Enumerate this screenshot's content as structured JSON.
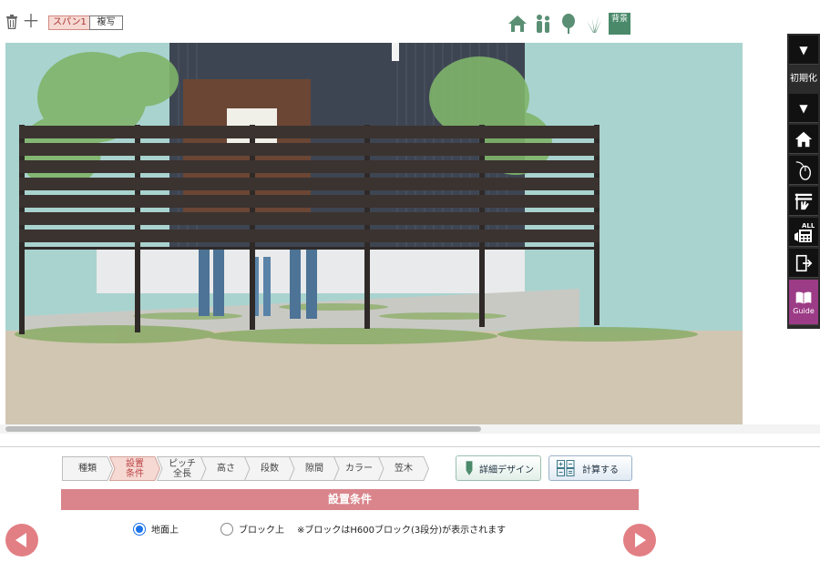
{
  "toolbar": {
    "span_tab_label": "スパン1",
    "copy_label": "複写",
    "background_label": "背景",
    "view_icons": [
      "house-icon",
      "people-icon",
      "tree-icon",
      "grass-icon",
      "background-icon"
    ]
  },
  "right_toolbar": {
    "reset_label": "初期化",
    "guide_label": "Guide",
    "all_label": "ALL",
    "items": [
      "collapse-arrow-icon",
      "reset-button",
      "expand-arrow-icon",
      "home-icon",
      "mouse-icon",
      "fence-hand-icon",
      "calculator-all-icon",
      "exit-door-icon",
      "guide-book-icon"
    ]
  },
  "steps": [
    {
      "label": "種類"
    },
    {
      "label": "設置\n条件",
      "active": true
    },
    {
      "label": "ピッチ\n全長"
    },
    {
      "label": "高さ"
    },
    {
      "label": "段数"
    },
    {
      "label": "隙間"
    },
    {
      "label": "カラー"
    },
    {
      "label": "笠木"
    }
  ],
  "actions": {
    "detail_design_label": "詳細デザイン",
    "calculate_label": "計算する"
  },
  "section": {
    "title": "設置条件"
  },
  "install_options": {
    "ground_label": "地面上",
    "block_label": "ブロック上",
    "note": "※ブロックはH600ブロック(3段分)が表示されます",
    "selected": "ground"
  },
  "colors": {
    "accent_pink": "#d9858b",
    "nav_circle": "#e27f84",
    "fence_dark": "#3b3330",
    "sky": "#a9d3cf",
    "ground": "#d1c6b2",
    "radio_selected": "#1a73e8"
  }
}
